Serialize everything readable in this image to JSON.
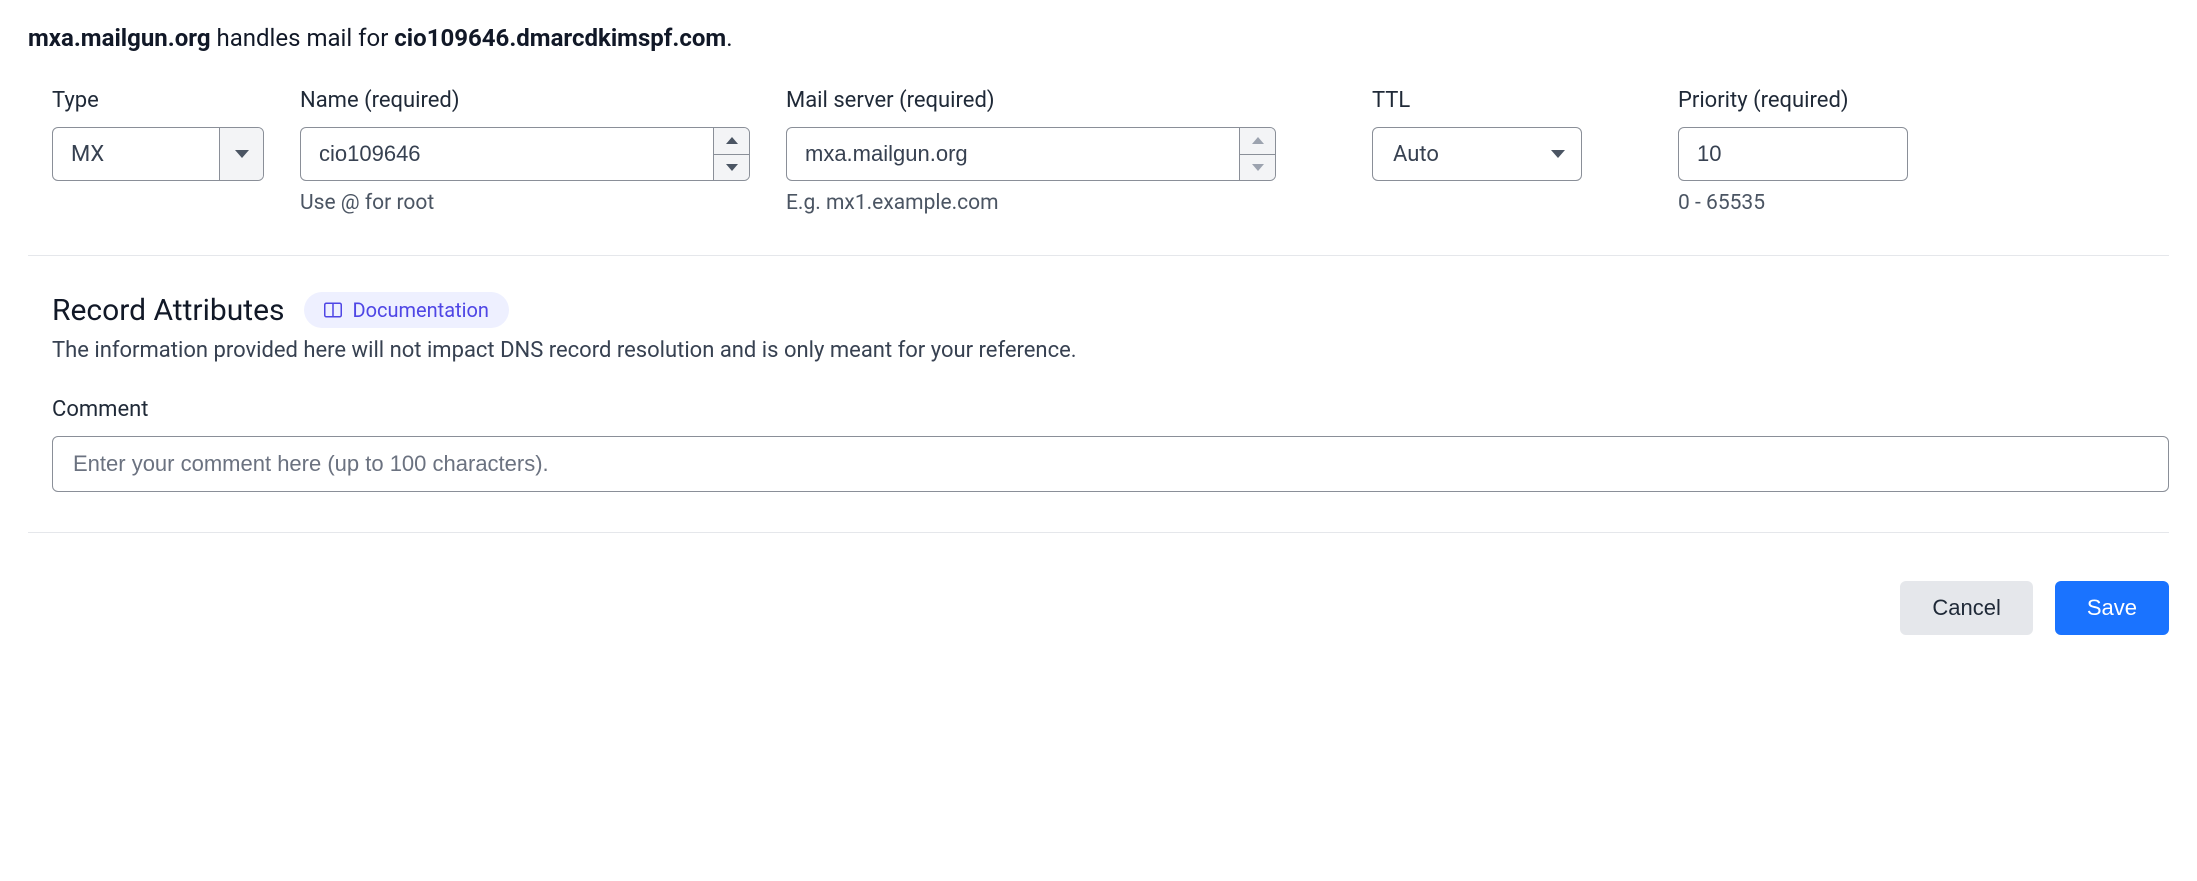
{
  "summary": {
    "server": "mxa.mailgun.org",
    "middle": " handles mail for ",
    "domain": "cio109646.dmarcdkimspf.com",
    "trailing": "."
  },
  "fields": {
    "type": {
      "label": "Type",
      "value": "MX"
    },
    "name": {
      "label": "Name (required)",
      "value": "cio109646",
      "help": "Use @ for root"
    },
    "mail": {
      "label": "Mail server (required)",
      "value": "mxa.mailgun.org",
      "help": "E.g. mx1.example.com"
    },
    "ttl": {
      "label": "TTL",
      "value": "Auto"
    },
    "prio": {
      "label": "Priority (required)",
      "value": "10",
      "help": "0 - 65535"
    }
  },
  "attrs": {
    "heading": "Record Attributes",
    "doc_label": "Documentation",
    "description": "The information provided here will not impact DNS record resolution and is only meant for your reference.",
    "comment_label": "Comment",
    "comment_placeholder": "Enter your comment here (up to 100 characters)."
  },
  "footer": {
    "cancel": "Cancel",
    "save": "Save"
  }
}
